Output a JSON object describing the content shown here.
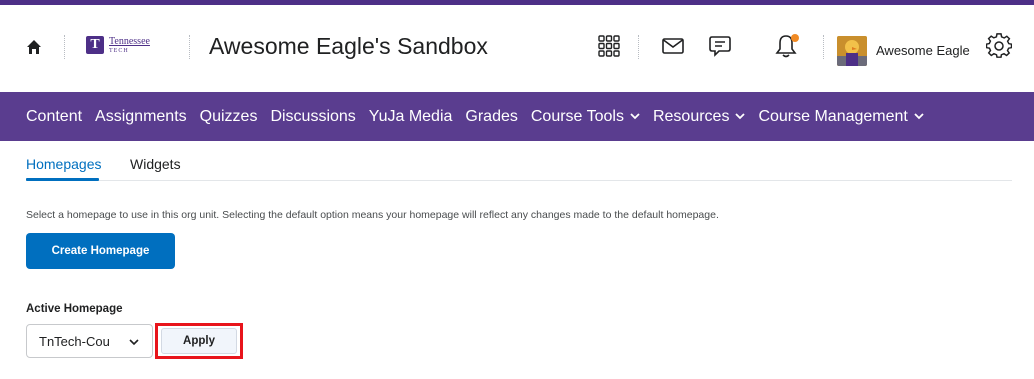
{
  "header": {
    "logo_name": "Tennessee",
    "logo_sub": "TECH",
    "logo_mark": "T",
    "course_title": "Awesome Eagle's Sandbox",
    "username": "Awesome Eagle",
    "icons": [
      "home-icon",
      "waffle-grid-icon",
      "mail-icon",
      "chat-icon",
      "bell-icon",
      "gear-icon"
    ]
  },
  "nav": {
    "items": [
      {
        "label": "Content",
        "dropdown": false
      },
      {
        "label": "Assignments",
        "dropdown": false
      },
      {
        "label": "Quizzes",
        "dropdown": false
      },
      {
        "label": "Discussions",
        "dropdown": false
      },
      {
        "label": "YuJa Media",
        "dropdown": false
      },
      {
        "label": "Grades",
        "dropdown": false
      },
      {
        "label": "Course Tools",
        "dropdown": true
      },
      {
        "label": "Resources",
        "dropdown": true
      },
      {
        "label": "Course Management",
        "dropdown": true
      }
    ]
  },
  "tabs": [
    {
      "label": "Homepages",
      "active": true
    },
    {
      "label": "Widgets",
      "active": false
    }
  ],
  "main": {
    "description": "Select a homepage to use in this org unit. Selecting the default option means your homepage will reflect any changes made to the default homepage.",
    "create_button": "Create Homepage",
    "active_label": "Active Homepage",
    "select_value": "TnTech-Cou",
    "apply_button": "Apply"
  },
  "colors": {
    "brand_purple": "#5a3d8f",
    "primary_blue": "#006fbf",
    "notification_dot": "#f08a24",
    "highlight_red": "#e8141b"
  }
}
